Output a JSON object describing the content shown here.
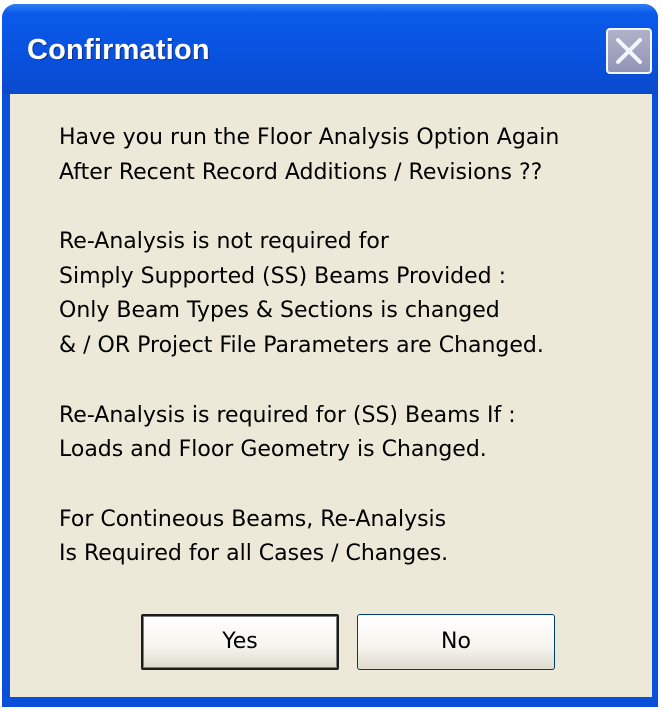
{
  "dialog": {
    "title": "Confirmation",
    "close_icon": "close-icon",
    "message_paragraphs": [
      [
        "Have you run the Floor Analysis Option Again",
        "After Recent Record Additions / Revisions ??"
      ],
      [
        "Re-Analysis is not required for",
        "Simply Supported (SS) Beams Provided :",
        "Only Beam Types & Sections is changed",
        "& / OR Project File Parameters are Changed."
      ],
      [
        "Re-Analysis is required for (SS) Beams If :",
        "Loads and Floor Geometry is Changed."
      ],
      [
        "For Contineous Beams, Re-Analysis",
        "Is Required for all Cases / Changes."
      ]
    ],
    "buttons": {
      "yes": "Yes",
      "no": "No"
    },
    "colors": {
      "titlebar": "#0852df",
      "client_background": "#ece9d8",
      "close_button": "#a9a7bf"
    }
  }
}
